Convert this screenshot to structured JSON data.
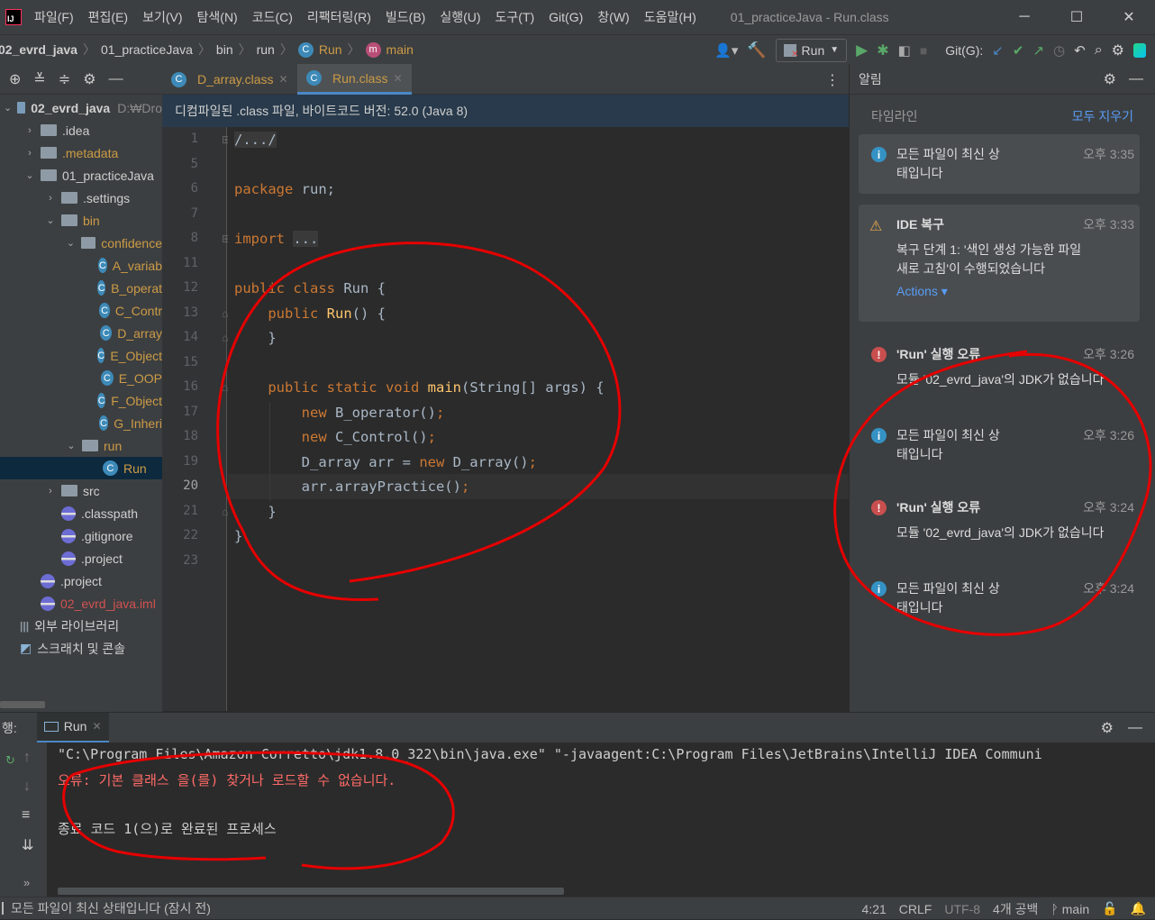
{
  "app": {
    "logo": "IJ",
    "title": "01_practiceJava - Run.class"
  },
  "menu": [
    "파일(F)",
    "편집(E)",
    "보기(V)",
    "탐색(N)",
    "코드(C)",
    "리팩터링(R)",
    "빌드(B)",
    "실행(U)",
    "도구(T)",
    "Git(G)",
    "창(W)",
    "도움말(H)"
  ],
  "breadcrumb": [
    "02_evrd_java",
    "01_practiceJava",
    "bin",
    "run",
    "Run",
    "main"
  ],
  "toolbar": {
    "run_config": "Run",
    "git_label": "Git(G):"
  },
  "project": {
    "rows": [
      {
        "label": "02_evrd_java",
        "extra": "D:₩Dro",
        "indent": 0,
        "type": "module",
        "arrow": "open",
        "bold": true
      },
      {
        "label": ".idea",
        "indent": 1,
        "type": "folder",
        "arrow": "closed"
      },
      {
        "label": ".metadata",
        "indent": 1,
        "type": "folder",
        "arrow": "closed",
        "color": "#cc9b46"
      },
      {
        "label": "01_practiceJava",
        "indent": 1,
        "type": "folder",
        "arrow": "open"
      },
      {
        "label": ".settings",
        "indent": 2,
        "type": "folder",
        "arrow": "closed"
      },
      {
        "label": "bin",
        "indent": 2,
        "type": "folder",
        "arrow": "open",
        "color": "#cc9b46"
      },
      {
        "label": "confidence",
        "indent": 3,
        "type": "folder",
        "arrow": "open",
        "color": "#cc9b46"
      },
      {
        "label": "A_variab",
        "indent": 4,
        "type": "class",
        "color": "#cc9b46"
      },
      {
        "label": "B_operat",
        "indent": 4,
        "type": "class",
        "color": "#cc9b46"
      },
      {
        "label": "C_Contr",
        "indent": 4,
        "type": "class",
        "color": "#cc9b46"
      },
      {
        "label": "D_array",
        "indent": 4,
        "type": "class",
        "color": "#cc9b46"
      },
      {
        "label": "E_Object",
        "indent": 4,
        "type": "class",
        "color": "#cc9b46"
      },
      {
        "label": "E_OOP",
        "indent": 4,
        "type": "class",
        "color": "#cc9b46"
      },
      {
        "label": "F_Object",
        "indent": 4,
        "type": "class",
        "color": "#cc9b46"
      },
      {
        "label": "G_Inheri",
        "indent": 4,
        "type": "class",
        "color": "#cc9b46"
      },
      {
        "label": "run",
        "indent": 3,
        "type": "folder",
        "arrow": "open",
        "color": "#cc9b46"
      },
      {
        "label": "Run",
        "indent": 4,
        "type": "class",
        "color": "#cc9b46",
        "selected": true
      },
      {
        "label": "src",
        "indent": 2,
        "type": "folder",
        "arrow": "closed"
      },
      {
        "label": ".classpath",
        "indent": 2,
        "type": "file"
      },
      {
        "label": ".gitignore",
        "indent": 2,
        "type": "file"
      },
      {
        "label": ".project",
        "indent": 2,
        "type": "file"
      },
      {
        "label": ".project",
        "indent": 1,
        "type": "file"
      },
      {
        "label": "02_evrd_java.iml",
        "indent": 1,
        "type": "file",
        "color": "#d25252"
      },
      {
        "label": "외부 라이브러리",
        "indent": 0,
        "type": "lib"
      },
      {
        "label": "스크래치 및 콘솔",
        "indent": 0,
        "type": "scratch"
      }
    ]
  },
  "editor": {
    "tabs": [
      {
        "label": "D_array.class",
        "active": false
      },
      {
        "label": "Run.class",
        "active": true
      }
    ],
    "banner": "디컴파일된 .class 파일, 바이트코드 버전: 52.0 (Java 8)",
    "line_numbers": [
      "1",
      "5",
      "6",
      "7",
      "8",
      "11",
      "12",
      "13",
      "14",
      "15",
      "16",
      "17",
      "18",
      "19",
      "20",
      "21",
      "22",
      "23"
    ],
    "current_line": "20"
  },
  "notifications": {
    "title": "알림",
    "timeline": "타임라인",
    "clear_all": "모두 지우기",
    "items": [
      {
        "type": "info",
        "text": "모든 파일이 최신 상\n태입니다",
        "time": "오후 3:35",
        "card": true
      },
      {
        "type": "warn",
        "title": "IDE 복구",
        "text": "복구 단계 1: '색인 생성 가능한 파일\n새로 고침'이 수행되었습니다",
        "time": "오후 3:33",
        "action": "Actions",
        "card": true
      },
      {
        "type": "error",
        "title": "'Run' 실행 오류",
        "text": "모듈 '02_evrd_java'의 JDK가 없습니다",
        "time": "오후 3:26"
      },
      {
        "type": "info",
        "text": "모든 파일이 최신 상\n태입니다",
        "time": "오후 3:26"
      },
      {
        "type": "error",
        "title": "'Run' 실행 오류",
        "text": "모듈 '02_evrd_java'의 JDK가 없습니다",
        "time": "오후 3:24"
      },
      {
        "type": "info",
        "text": "모든 파일이 최신 상\n태입니다",
        "time": "오후 3:24"
      }
    ]
  },
  "run_panel": {
    "prefix": "행:",
    "tab": "Run",
    "lines": [
      {
        "text": "\"C:\\Program Files\\Amazon Corretto\\jdk1.8.0_322\\bin\\java.exe\" \"-javaagent:C:\\Program Files\\JetBrains\\IntelliJ IDEA Communi",
        "color": "#cfcfcf"
      },
      {
        "text": "오류: 기본 클래스 을(를) 찾거나 로드할 수 없습니다.",
        "color": "#ff6b68"
      },
      {
        "text": "",
        "color": "#cfcfcf"
      },
      {
        "text": "종료 코드 1(으)로 완료된 프로세스",
        "color": "#cfcfcf"
      }
    ]
  },
  "status": {
    "message": "모든 파일이 최신 상태입니다 (잠시 전)",
    "position": "4:21",
    "line_sep": "CRLF",
    "encoding": "UTF-8",
    "indent": "4개 공백",
    "branch": "main"
  },
  "colors": {
    "keyword": "#cc7832",
    "function": "#ffc66d",
    "annotation": "#e60000"
  }
}
